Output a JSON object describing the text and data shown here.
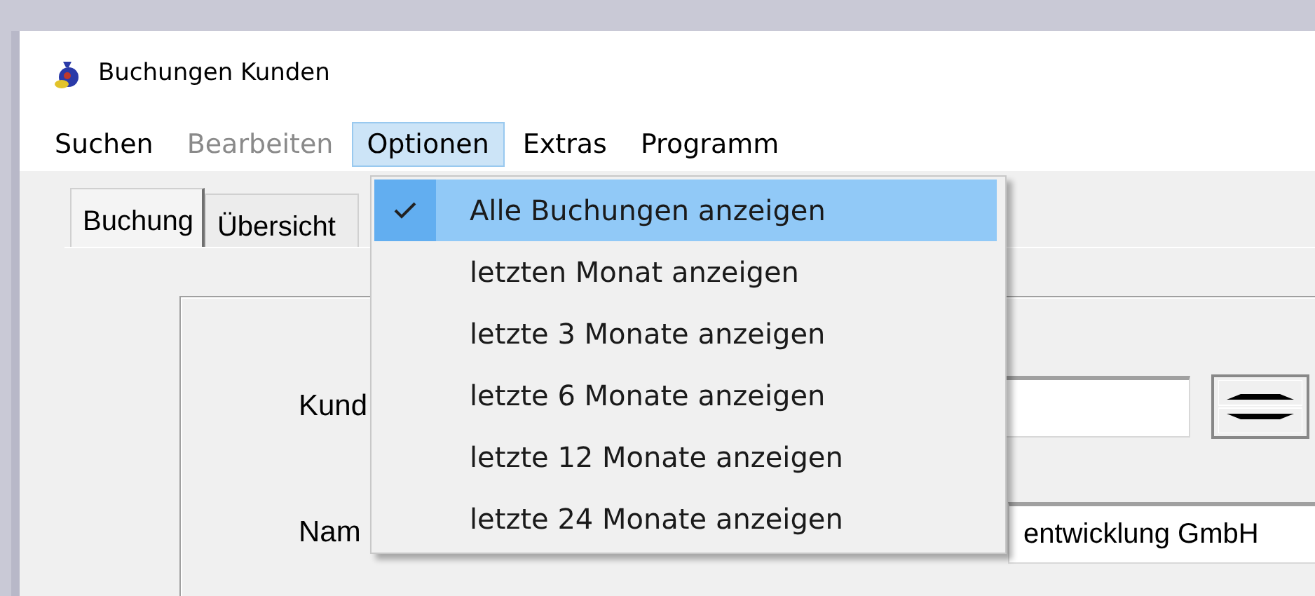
{
  "window": {
    "title": "Buchungen Kunden"
  },
  "menu_bar": [
    {
      "label": "Suchen",
      "disabled": false,
      "selected": false
    },
    {
      "label": "Bearbeiten",
      "disabled": true,
      "selected": false
    },
    {
      "label": "Optionen",
      "disabled": false,
      "selected": true
    },
    {
      "label": "Extras",
      "disabled": false,
      "selected": false
    },
    {
      "label": "Programm",
      "disabled": false,
      "selected": false
    }
  ],
  "tabs": [
    {
      "label": "Buchung",
      "selected": true
    },
    {
      "label": "Übersicht",
      "selected": false
    }
  ],
  "form": {
    "fields": [
      {
        "label": "Kund",
        "spin": true
      },
      {
        "label": "Nam",
        "value": "entwicklung GmbH",
        "spin": false
      }
    ]
  },
  "options_menu": [
    {
      "label": "Alle Buchungen anzeigen",
      "checked": true,
      "selected": true
    },
    {
      "label": "letzten Monat anzeigen",
      "checked": false,
      "selected": false
    },
    {
      "label": "letzte 3 Monate anzeigen",
      "checked": false,
      "selected": false
    },
    {
      "label": "letzte 6 Monate anzeigen",
      "checked": false,
      "selected": false
    },
    {
      "label": "letzte 12 Monate anzeigen",
      "checked": false,
      "selected": false
    },
    {
      "label": "letzte 24 Monate anzeigen",
      "checked": false,
      "selected": false
    }
  ]
}
